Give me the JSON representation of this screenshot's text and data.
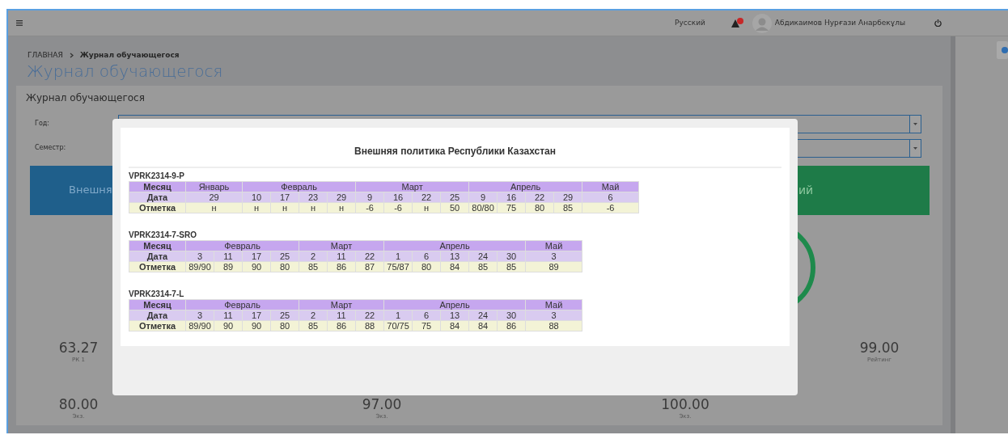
{
  "navbar": {
    "language": "Русский",
    "user_name": "Абдикаимов Нурғази Анарбекұлы"
  },
  "breadcrumb": [
    "ГЛАВНАЯ",
    "Журнал обучающегося"
  ],
  "page_title": "Журнал обучающегося",
  "panel": {
    "title": "Журнал обучающегося",
    "filters": [
      {
        "label": "Год:"
      },
      {
        "label": "Семестр:"
      }
    ],
    "columns": [
      {
        "kind": "blue",
        "card_title": "Внешня",
        "rows": [
          {
            "cells": [
              {
                "value": "63.27",
                "label": "РК 1"
              }
            ]
          },
          {
            "cells": [
              {
                "value": "80.00",
                "label": "Экз."
              }
            ]
          }
        ]
      },
      {
        "kind": "none",
        "rows": [
          {
            "cells": [
              {
                "value": "97.00",
                "label": "Экз."
              }
            ]
          }
        ]
      },
      {
        "kind": "green",
        "card_title": "ий",
        "rows": [
          {
            "cells": [
              {
                "value": "99.00",
                "label": "Рейтинг"
              }
            ]
          },
          {
            "cells": [
              {
                "value": "100.00",
                "label": "Экз."
              }
            ]
          }
        ]
      }
    ]
  },
  "modal": {
    "title": "Внешняя политика Республики Казахстан",
    "journals": [
      {
        "code": "VPRK2314-9-P",
        "row_labels": [
          "Месяц",
          "Дата",
          "Отметка"
        ],
        "months": [
          {
            "name": "Январь",
            "entries": [
              {
                "date": "29",
                "mark": "н"
              }
            ]
          },
          {
            "name": "Февраль",
            "entries": [
              {
                "date": "10",
                "mark": "н"
              },
              {
                "date": "17",
                "mark": "н"
              },
              {
                "date": "23",
                "mark": "н"
              },
              {
                "date": "29",
                "mark": "н"
              }
            ]
          },
          {
            "name": "Март",
            "entries": [
              {
                "date": "9",
                "mark": "-6"
              },
              {
                "date": "16",
                "mark": "-6"
              },
              {
                "date": "22",
                "mark": "н"
              },
              {
                "date": "25",
                "mark": "50"
              }
            ]
          },
          {
            "name": "Апрель",
            "entries": [
              {
                "date": "9",
                "mark": "80/80"
              },
              {
                "date": "16",
                "mark": "75"
              },
              {
                "date": "22",
                "mark": "80"
              },
              {
                "date": "29",
                "mark": "85"
              }
            ]
          },
          {
            "name": "Май",
            "entries": [
              {
                "date": "6",
                "mark": "-6"
              }
            ]
          }
        ]
      },
      {
        "code": "VPRK2314-7-SRO",
        "row_labels": [
          "Месяц",
          "Дата",
          "Отметка"
        ],
        "months": [
          {
            "name": "Февраль",
            "entries": [
              {
                "date": "3",
                "mark": "89/90"
              },
              {
                "date": "11",
                "mark": "89"
              },
              {
                "date": "17",
                "mark": "90"
              },
              {
                "date": "25",
                "mark": "80"
              }
            ]
          },
          {
            "name": "Март",
            "entries": [
              {
                "date": "2",
                "mark": "85"
              },
              {
                "date": "11",
                "mark": "86"
              },
              {
                "date": "22",
                "mark": "87"
              }
            ]
          },
          {
            "name": "Апрель",
            "entries": [
              {
                "date": "1",
                "mark": "75/87"
              },
              {
                "date": "6",
                "mark": "80"
              },
              {
                "date": "13",
                "mark": "84"
              },
              {
                "date": "24",
                "mark": "85"
              },
              {
                "date": "30",
                "mark": "85"
              }
            ]
          },
          {
            "name": "Май",
            "entries": [
              {
                "date": "3",
                "mark": "89"
              }
            ]
          }
        ]
      },
      {
        "code": "VPRK2314-7-L",
        "row_labels": [
          "Месяц",
          "Дата",
          "Отметка"
        ],
        "months": [
          {
            "name": "Февраль",
            "entries": [
              {
                "date": "3",
                "mark": "89/90"
              },
              {
                "date": "11",
                "mark": "90"
              },
              {
                "date": "17",
                "mark": "90"
              },
              {
                "date": "25",
                "mark": "80"
              }
            ]
          },
          {
            "name": "Март",
            "entries": [
              {
                "date": "2",
                "mark": "85"
              },
              {
                "date": "11",
                "mark": "86"
              },
              {
                "date": "22",
                "mark": "88"
              }
            ]
          },
          {
            "name": "Апрель",
            "entries": [
              {
                "date": "1",
                "mark": "70/75"
              },
              {
                "date": "6",
                "mark": "75"
              },
              {
                "date": "13",
                "mark": "84"
              },
              {
                "date": "24",
                "mark": "84"
              },
              {
                "date": "30",
                "mark": "86"
              }
            ]
          },
          {
            "name": "Май",
            "entries": [
              {
                "date": "3",
                "mark": "88"
              }
            ]
          }
        ]
      }
    ]
  }
}
